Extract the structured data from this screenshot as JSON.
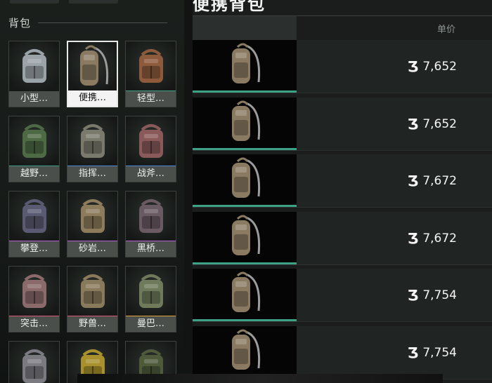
{
  "left_panel": {
    "section_title": "背包",
    "items": [
      {
        "label": "小型…",
        "color": "#9aa3a8",
        "icon": "body-armor-icon",
        "rarity": ""
      },
      {
        "label": "便携…",
        "color": "#8a7a62",
        "icon": "sling-backpack-icon",
        "rarity": "",
        "selected": true
      },
      {
        "label": "轻型…",
        "color": "#8e5a3c",
        "icon": "light-backpack-icon",
        "rarity": "#3ea186"
      },
      {
        "label": "越野…",
        "color": "#4e6a44",
        "icon": "offroad-backpack-icon",
        "rarity": "#3ea186"
      },
      {
        "label": "指挥…",
        "color": "#7a7a6c",
        "icon": "command-backpack-icon",
        "rarity": "#4a8fd8"
      },
      {
        "label": "战斧…",
        "color": "#8a5a5a",
        "icon": "tomahawk-backpack-icon",
        "rarity": "#4a8fd8"
      },
      {
        "label": "攀登…",
        "color": "#5a5a72",
        "icon": "climbing-backpack-icon",
        "rarity": "#b85fd8"
      },
      {
        "label": "砂岩…",
        "color": "#8c7c5c",
        "icon": "sandstone-backpack-icon",
        "rarity": "#b85fd8"
      },
      {
        "label": "黑桥…",
        "color": "#6a5a62",
        "icon": "blackbridge-backpack-icon",
        "rarity": "#b85fd8"
      },
      {
        "label": "突击…",
        "color": "#8a6a6a",
        "icon": "assault-backpack-icon",
        "rarity": "#e0557a"
      },
      {
        "label": "野兽…",
        "color": "#8a7a5c",
        "icon": "beast-backpack-icon",
        "rarity": "#e0557a"
      },
      {
        "label": "曼巴…",
        "color": "#6e7a5a",
        "icon": "mamba-backpack-icon",
        "rarity": "#e8a23a"
      },
      {
        "label": "",
        "color": "#7a7a80",
        "icon": "backpack-icon",
        "rarity": ""
      },
      {
        "label": "",
        "color": "#a8902c",
        "icon": "gold-backpack-icon",
        "rarity": ""
      },
      {
        "label": "",
        "color": "#4e5a3a",
        "icon": "ghillie-backpack-icon",
        "rarity": ""
      }
    ]
  },
  "right_panel": {
    "title": "便携背包",
    "price_header": "单价",
    "currency_icon": "havoc-coin-icon",
    "listings": [
      {
        "price": "7,652"
      },
      {
        "price": "7,652"
      },
      {
        "price": "7,672"
      },
      {
        "price": "7,672"
      },
      {
        "price": "7,754"
      },
      {
        "price": "7,754"
      }
    ]
  },
  "colors": {
    "rarity_green": "#3ea186",
    "selected_border": "#e8e8e8",
    "panel_bg": "#1a1d1c"
  }
}
